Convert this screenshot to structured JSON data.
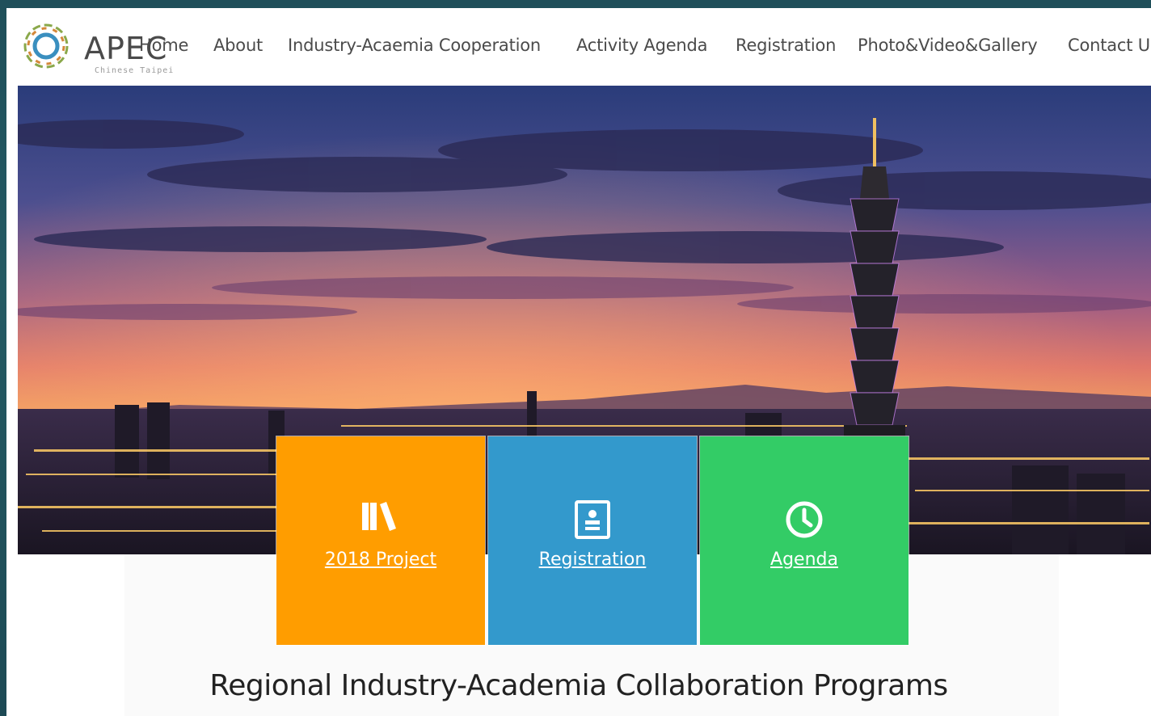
{
  "logo": {
    "brand": "APEC",
    "subtitle": "Chinese Taipei"
  },
  "nav": {
    "items": [
      {
        "label": "Home"
      },
      {
        "label": "About"
      },
      {
        "label": "Industry-Acaemia Cooperation"
      },
      {
        "label": "Activity Agenda"
      },
      {
        "label": "Registration"
      },
      {
        "label": "Photo&Video&Gallery"
      },
      {
        "label": "Contact U"
      }
    ]
  },
  "tiles": [
    {
      "label": "2018 Project",
      "icon": "books-icon",
      "color": "#ff9d00"
    },
    {
      "label": "Registration",
      "icon": "id-card-icon",
      "color": "#3399cc"
    },
    {
      "label": "Agenda",
      "icon": "clock-icon",
      "color": "#33cc66"
    }
  ],
  "main": {
    "headline": "Regional Industry-Academia Collaboration Programs"
  }
}
